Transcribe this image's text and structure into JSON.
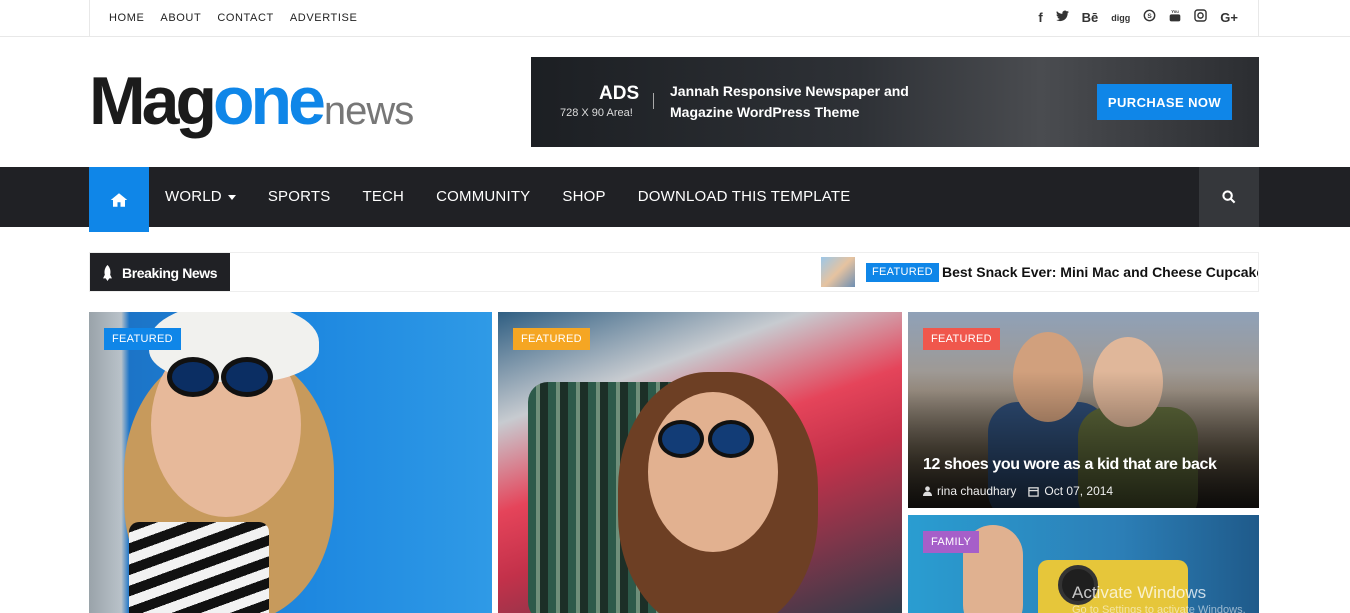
{
  "topbar": {
    "links": [
      "HOME",
      "ABOUT",
      "CONTACT",
      "ADVERTISE"
    ],
    "social_icons": [
      {
        "name": "facebook-icon",
        "glyph": "f"
      },
      {
        "name": "twitter-icon",
        "glyph": "ᴛ"
      },
      {
        "name": "behance-icon",
        "glyph": "Bē"
      },
      {
        "name": "digg-icon",
        "glyph": "digg"
      },
      {
        "name": "skype-icon",
        "glyph": "S"
      },
      {
        "name": "youtube-icon",
        "glyph": "▶"
      },
      {
        "name": "instagram-icon",
        "glyph": "▣"
      },
      {
        "name": "google-plus-icon",
        "glyph": "G+"
      }
    ]
  },
  "logo": {
    "part1": "Mag",
    "part2": "one",
    "part3": "news"
  },
  "ad": {
    "title": "ADS",
    "size": "728 X 90 Area!",
    "text": "Jannah Responsive Newspaper and Magazine WordPress Theme",
    "button": "PURCHASE NOW"
  },
  "nav": {
    "items": [
      "WORLD",
      "SPORTS",
      "TECH",
      "COMMUNITY",
      "SHOP",
      "DOWNLOAD THIS TEMPLATE"
    ]
  },
  "breaking": {
    "label": "Breaking News",
    "tag": "FEATURED",
    "headline": "Best Snack Ever: Mini Mac and Cheese Cupcakes"
  },
  "cards": [
    {
      "tag": "FEATURED",
      "tag_color": "#0f86e8"
    },
    {
      "tag": "FEATURED",
      "tag_color": "#f5a623"
    },
    {
      "tag": "FEATURED",
      "tag_color": "#f0574c",
      "title": "12 shoes you wore as a kid that are back",
      "author": "rina chaudhary",
      "date": "Oct 07, 2014"
    },
    {
      "tag": "FAMILY",
      "tag_color": "#a65fc9"
    }
  ],
  "watermark": {
    "line1": "Activate Windows",
    "line2": "Go to Settings to activate Windows."
  },
  "colors": {
    "accent": "#0f86e8",
    "nav_bg": "#202125"
  }
}
